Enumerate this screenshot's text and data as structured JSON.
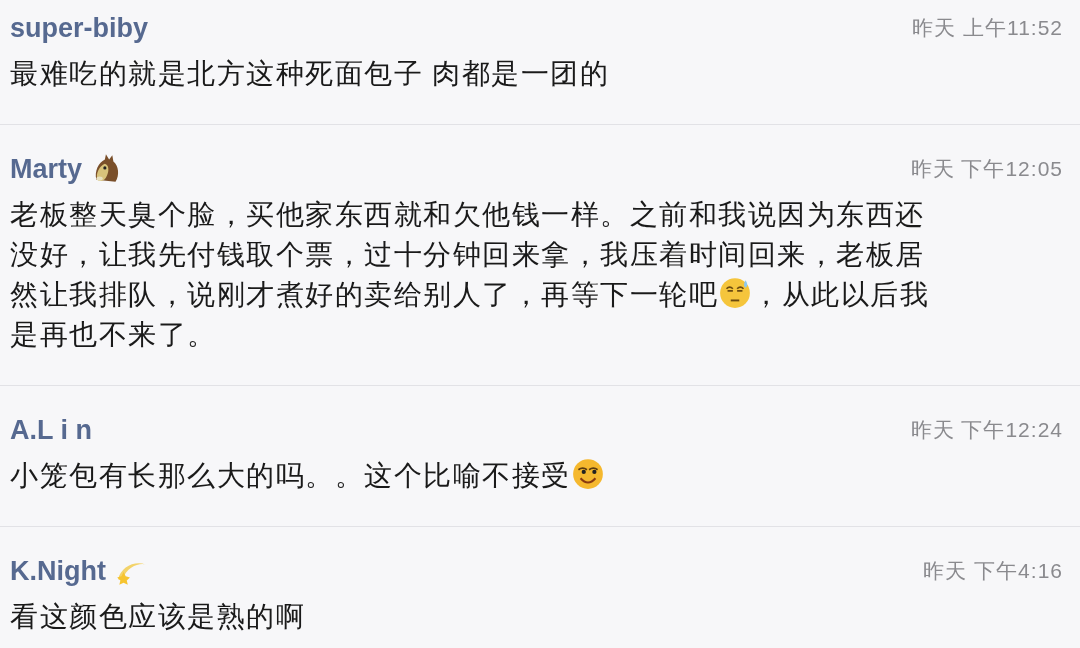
{
  "comments": [
    {
      "user": "super-biby",
      "name_emoji": false,
      "time": "昨天 上午11:52",
      "lines": [
        [
          {
            "kind": "text",
            "text": "最难吃的就是北方这种死面包子 肉都是一团的"
          }
        ]
      ]
    },
    {
      "user": "Marty",
      "name_emoji": true,
      "time": "昨天 下午12:05",
      "lines": [
        [
          {
            "kind": "text",
            "text": "老板整天臭个脸，买他家东西就和欠他钱一样。之前和我说因为东西还"
          }
        ],
        [
          {
            "kind": "text",
            "text": "没好，让我先付钱取个票，过十分钟回来拿，我压着时间回来，老板居"
          }
        ],
        [
          {
            "kind": "text",
            "text": "然让我排队，说刚才煮好的卖给别人了，再等下一轮吧"
          },
          {
            "kind": "emoji"
          },
          {
            "kind": "text",
            "text": "，从此以后我"
          }
        ],
        [
          {
            "kind": "text",
            "text": "是再也不来了。"
          }
        ]
      ]
    },
    {
      "user": "A.L i n",
      "name_emoji": false,
      "time": "昨天 下午12:24",
      "lines": [
        [
          {
            "kind": "text",
            "text": "小笼包有长那么大的吗。。这个比喻不接受"
          },
          {
            "kind": "emoji"
          }
        ]
      ]
    },
    {
      "user": "K.Night",
      "name_emoji": true,
      "time": "昨天 下午4:16",
      "lines": [
        [
          {
            "kind": "text",
            "text": "看这颜色应该是熟的啊"
          }
        ]
      ]
    }
  ]
}
